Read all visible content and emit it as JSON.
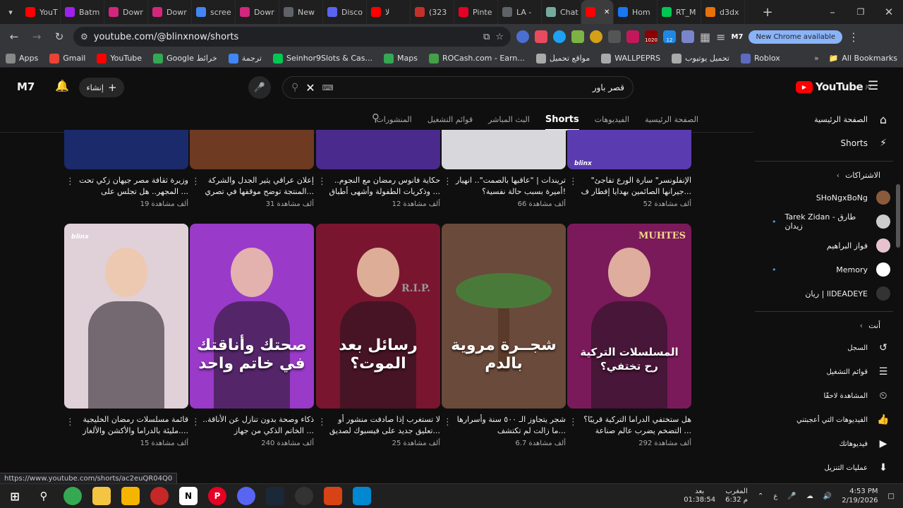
{
  "tabs": [
    {
      "label": "YouT",
      "color": "#ff0000"
    },
    {
      "label": "Batm",
      "color": "#a020f0"
    },
    {
      "label": "Dowr",
      "color": "#d4267e"
    },
    {
      "label": "Dowr",
      "color": "#d4267e"
    },
    {
      "label": "scree",
      "color": "#4285f4"
    },
    {
      "label": "Dowr",
      "color": "#d4267e"
    },
    {
      "label": "New",
      "color": "#5f6368"
    },
    {
      "label": "Disco",
      "color": "#5865f2"
    },
    {
      "label": "لا",
      "color": "#ff0000"
    },
    {
      "label": "(323",
      "color": "#c4302b"
    },
    {
      "label": "Pinte",
      "color": "#e60023"
    },
    {
      "label": "LA -",
      "color": "#5f6368"
    },
    {
      "label": "Chat",
      "color": "#74aa9c"
    },
    {
      "label": "",
      "color": "#ff0000",
      "active": true
    },
    {
      "label": "Hom",
      "color": "#1877f2"
    },
    {
      "label": "RT_M",
      "color": "#00c853"
    },
    {
      "label": "d3dx",
      "color": "#e8710a"
    }
  ],
  "address": {
    "url": "youtube.com/@blinxnow/shorts",
    "chrome_badge": "New Chrome available",
    "profile": "M7",
    "ext_badge1": "1020",
    "ext_badge2": "12"
  },
  "bookmarks": [
    {
      "label": "Apps"
    },
    {
      "label": "Gmail"
    },
    {
      "label": "YouTube"
    },
    {
      "label": "Google خرائط"
    },
    {
      "label": "ترجمة"
    },
    {
      "label": "Seinhor9Slots & Cas..."
    },
    {
      "label": "Maps"
    },
    {
      "label": "ROCash.com - Earn..."
    },
    {
      "label": "مواقع تحميل"
    },
    {
      "label": "WALLPEPRS"
    },
    {
      "label": "تحميل يوتيوب"
    },
    {
      "label": "Roblox"
    }
  ],
  "all_bookmarks": "All Bookmarks",
  "yt": {
    "logo": "YouTube",
    "logo_sup": "JO",
    "avatar": "M7",
    "create": "إنشاء",
    "search_value": "قصر باور",
    "channel_tabs": [
      "الصفحة الرئيسية",
      "الفيديوهات",
      "Shorts",
      "البث المباشر",
      "قوائم التشغيل",
      "المنشورات"
    ]
  },
  "sidebar": {
    "home": "الصفحة الرئيسية",
    "shorts": "Shorts",
    "subs_header": "الاشتراكات",
    "subs": [
      {
        "label": "SHoNgxBoNg",
        "color": "#8a5a3c"
      },
      {
        "label": "Tarek Zidan - طارق زيدان",
        "color": "#ccc",
        "dot": true
      },
      {
        "label": "فواز البراهيم",
        "color": "#e7c3d0"
      },
      {
        "label": "Memory",
        "color": "#fff",
        "dot": true
      },
      {
        "label": "ريان | llDEADEYE",
        "color": "#333"
      }
    ],
    "you_header": "أنت",
    "you": [
      "السجل",
      "قوائم التشغيل",
      "المشاهدة لاحقًا",
      "الفيديوهات التي أعجبتني",
      "فيديوهاتك",
      "عمليات التنزيل"
    ]
  },
  "row1": [
    {
      "title": "\"الإنفلونسر\" سارة الورع تفاجئ جيرانها الصائمين بهدايا إفطار ف...",
      "views": "52 ألف مشاهدة",
      "bg": "#5a3cb0"
    },
    {
      "title": "تريندات | \"عاقبها بالصمت\".. انهيار أميرة بسبب حالة نفسية؟!",
      "views": "66 ألف مشاهدة",
      "bg": "#d8d8dc"
    },
    {
      "title": "حكاية فانوس رمضان مع النجوم.. وذكريات الطفولة وأشهى أطباق ...",
      "views": "12 ألف مشاهدة",
      "bg": "#4a2a8c"
    },
    {
      "title": "إعلان عراقي يثير الجدل والشركة المنتجة توضح موقفها في تصري...",
      "views": "31 ألف مشاهدة",
      "bg": "#6e3a22"
    },
    {
      "title": "وزيرة ثقافة مصر جيهان زكي تحت المجهر.. هل تجلس على ...",
      "views": "19 ألف مشاهدة",
      "bg": "#1a2a6a"
    }
  ],
  "row2": [
    {
      "title": "هل ستختفي الدراما التركية قريبًا؟ التضخم يضرب عالم صناعة ...",
      "views": "292 ألف مشاهدة",
      "bg": "#7a1a5a",
      "overlay": "المسلسلات التركية رح تختفي؟",
      "banner": "MUHTES"
    },
    {
      "title": "شجر يتجاوز الـ ٥٠٠ سنة وأسرارها ما زالت لم تكتشف...",
      "views": "6.7 ألف مشاهدة",
      "bg": "#6a4a3a",
      "overlay": "شجــرة مروية بالدم"
    },
    {
      "title": "لا تستغرب إذا صادفت منشور أو تعليق جديد على فيسبوك لصديق...",
      "views": "25 ألف مشاهدة",
      "bg": "#7a1530",
      "overlay": "رسائل بعد الموت؟",
      "rip": "R.I.P."
    },
    {
      "title": "ذكاء وصحة بدون تنازل عن الأناقة.. الخاتم الذكي من جهاز ...",
      "views": "240 ألف مشاهدة",
      "bg": "#9a3ac8",
      "overlay": "صحتك وأناقتك في خاتم واحد"
    },
    {
      "title": "قائمة مسلسلات رمضان الخليجية مليئة بالدراما والأكشن والألغاز....",
      "views": "15 ألف مشاهدة",
      "bg": "#e0d0d8",
      "badge": "blinx"
    }
  ],
  "row1_badge": "blinx",
  "status_url": "https://www.youtube.com/shorts/ac2euQR04Q0",
  "taskbar": {
    "time": "4:53 PM",
    "date": "2/19/2026",
    "prayer1": "بعد",
    "prayer1_time": "01:38:54",
    "prayer2": "المغرب",
    "prayer2_time": "6:32 م",
    "lang": "ع"
  }
}
